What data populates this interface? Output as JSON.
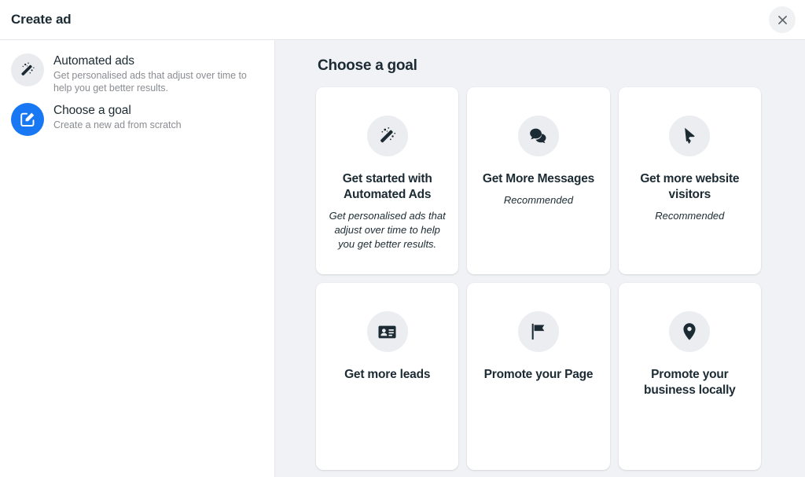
{
  "header": {
    "title": "Create ad",
    "close_icon": "close-icon"
  },
  "sidebar": {
    "items": [
      {
        "icon": "magic-wand-icon",
        "icon_style": "grey",
        "title": "Automated ads",
        "description": "Get personalised ads that adjust over time to help you get better results."
      },
      {
        "icon": "edit-square-icon",
        "icon_style": "blue",
        "title": "Choose a goal",
        "description": "Create a new ad from scratch"
      }
    ]
  },
  "main": {
    "heading": "Choose a goal",
    "cards": [
      {
        "icon": "magic-wand-icon",
        "title": "Get started with Automated Ads",
        "subtitle": "Get personalised ads that adjust over time to help you get better results."
      },
      {
        "icon": "speech-bubbles-icon",
        "title": "Get More Messages",
        "subtitle": "Recommended"
      },
      {
        "icon": "cursor-pointer-icon",
        "title": "Get more website visitors",
        "subtitle": "Recommended"
      },
      {
        "icon": "contact-card-icon",
        "title": "Get more leads",
        "subtitle": ""
      },
      {
        "icon": "flag-icon",
        "title": "Promote your Page",
        "subtitle": ""
      },
      {
        "icon": "map-pin-icon",
        "title": "Promote your business locally",
        "subtitle": ""
      }
    ]
  },
  "colors": {
    "accent_blue": "#1877f2",
    "text_primary": "#1c2b33",
    "text_secondary": "#8a8d91",
    "surface": "#ffffff",
    "background": "#f0f2f5",
    "icon_circle": "#ebedf0"
  }
}
